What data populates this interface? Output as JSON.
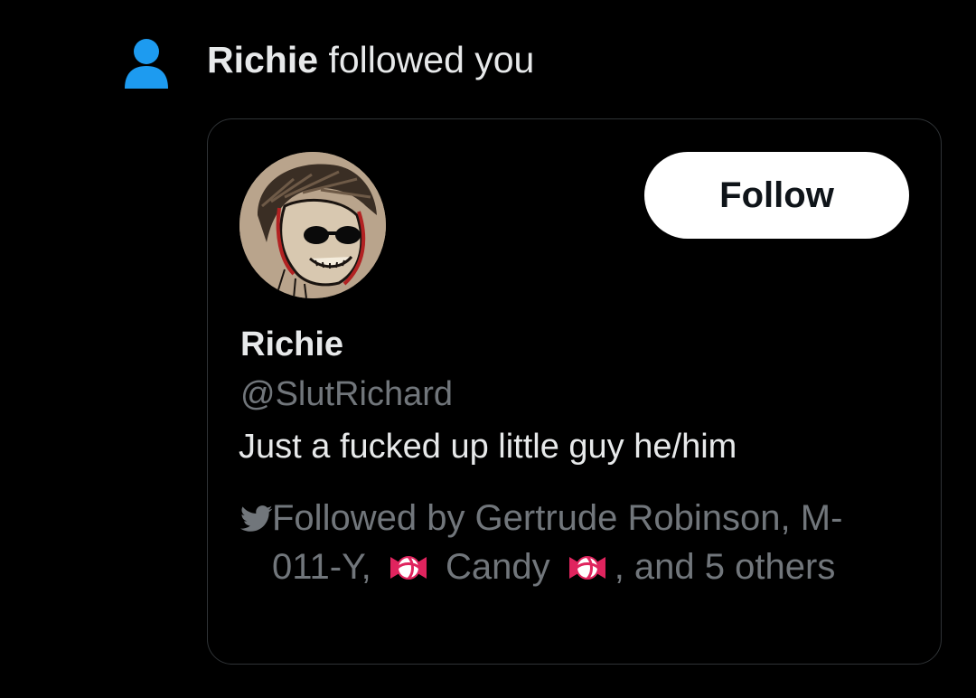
{
  "notification": {
    "actor": "Richie",
    "action": " followed you",
    "icon": "person-icon",
    "icon_color": "#1d9bf0"
  },
  "user_card": {
    "display_name": "Richie",
    "handle": "@SlutRichard",
    "bio": "Just a fucked up little guy he/him",
    "follow_label": "Follow",
    "followed_by": {
      "prefix": "Followed by Gertrude Robinson, M-011-Y, ",
      "middle": " Candy ",
      "suffix": ", and 5 others",
      "icon": "twitter-bird-icon",
      "emoji": "candy-icon"
    }
  },
  "colors": {
    "background": "#000000",
    "primary_text": "#e7e9ea",
    "secondary_text": "#71767b",
    "card_border": "#2f3336",
    "accent": "#1d9bf0",
    "button_bg": "#ffffff",
    "button_text": "#0f1419"
  }
}
